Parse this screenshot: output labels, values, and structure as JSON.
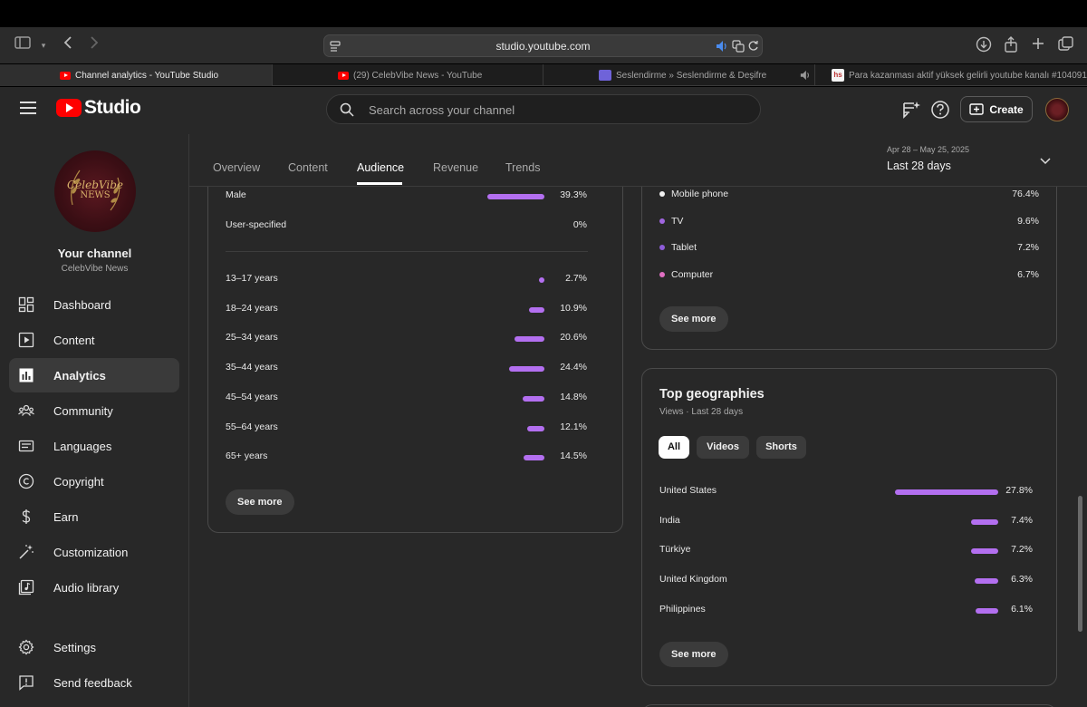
{
  "browser": {
    "url": "studio.youtube.com",
    "tabs": [
      {
        "title": "Channel analytics - YouTube Studio",
        "favicon": "youtube-icon"
      },
      {
        "title": "(29) CelebVibe News - YouTube",
        "favicon": "youtube-icon"
      },
      {
        "title": "Seslendirme » Seslendirme & Deşifre",
        "favicon": "seslendirme-icon"
      },
      {
        "title": "Para kazanması aktif yüksek gelirli youtube kanalı #104091",
        "favicon": "hs-icon"
      }
    ],
    "hs_favicon_text": "hs"
  },
  "header": {
    "logo_text": "Studio",
    "search_placeholder": "Search across your channel",
    "create_label": "Create"
  },
  "sidebar": {
    "avatar_line1": "CelebVibe",
    "avatar_line2": "NEWS",
    "your_channel": "Your channel",
    "channel_name": "CelebVibe News",
    "items": [
      {
        "label": "Dashboard",
        "icon": "dashboard-icon"
      },
      {
        "label": "Content",
        "icon": "content-icon"
      },
      {
        "label": "Analytics",
        "icon": "analytics-icon",
        "active": true
      },
      {
        "label": "Community",
        "icon": "community-icon"
      },
      {
        "label": "Languages",
        "icon": "languages-icon"
      },
      {
        "label": "Copyright",
        "icon": "copyright-icon"
      },
      {
        "label": "Earn",
        "icon": "earn-icon"
      },
      {
        "label": "Customization",
        "icon": "customization-icon"
      },
      {
        "label": "Audio library",
        "icon": "audio-library-icon"
      },
      {
        "label": "Settings",
        "icon": "settings-icon"
      },
      {
        "label": "Send feedback",
        "icon": "feedback-icon"
      }
    ]
  },
  "tabs": {
    "items": [
      "Overview",
      "Content",
      "Audience",
      "Revenue",
      "Trends"
    ],
    "active": "Audience",
    "date_range": "Apr 28 – May 25, 2025",
    "date_label": "Last 28 days"
  },
  "gender": [
    {
      "label": "Male",
      "value": "39.3%",
      "fraction": 0.393
    },
    {
      "label": "User-specified",
      "value": "0%",
      "fraction": 0
    }
  ],
  "age": [
    {
      "label": "13–17 years",
      "value": "2.7%",
      "fraction": 0.027
    },
    {
      "label": "18–24 years",
      "value": "10.9%",
      "fraction": 0.109
    },
    {
      "label": "25–34 years",
      "value": "20.6%",
      "fraction": 0.206
    },
    {
      "label": "35–44 years",
      "value": "24.4%",
      "fraction": 0.244
    },
    {
      "label": "45–54 years",
      "value": "14.8%",
      "fraction": 0.148
    },
    {
      "label": "55–64 years",
      "value": "12.1%",
      "fraction": 0.121
    },
    {
      "label": "65+ years",
      "value": "14.5%",
      "fraction": 0.145
    }
  ],
  "devices": [
    {
      "label": "Mobile phone",
      "value": "76.4%",
      "color": "#f1f1f1"
    },
    {
      "label": "TV",
      "value": "9.6%",
      "color": "#a066e0"
    },
    {
      "label": "Tablet",
      "value": "7.2%",
      "color": "#8e5cd9"
    },
    {
      "label": "Computer",
      "value": "6.7%",
      "color": "#e06fc2"
    }
  ],
  "see_more": "See more",
  "geographies": {
    "title": "Top geographies",
    "subtitle": "Views · Last 28 days",
    "chips": [
      "All",
      "Videos",
      "Shorts"
    ],
    "rows": [
      {
        "label": "United States",
        "value": "27.8%",
        "fraction": 0.278
      },
      {
        "label": "India",
        "value": "7.4%",
        "fraction": 0.074
      },
      {
        "label": "Türkiye",
        "value": "7.2%",
        "fraction": 0.072
      },
      {
        "label": "United Kingdom",
        "value": "6.3%",
        "fraction": 0.063
      },
      {
        "label": "Philippines",
        "value": "6.1%",
        "fraction": 0.061
      }
    ]
  },
  "colors": {
    "accent": "#b36ff0",
    "youtube_red": "#ff0000"
  }
}
